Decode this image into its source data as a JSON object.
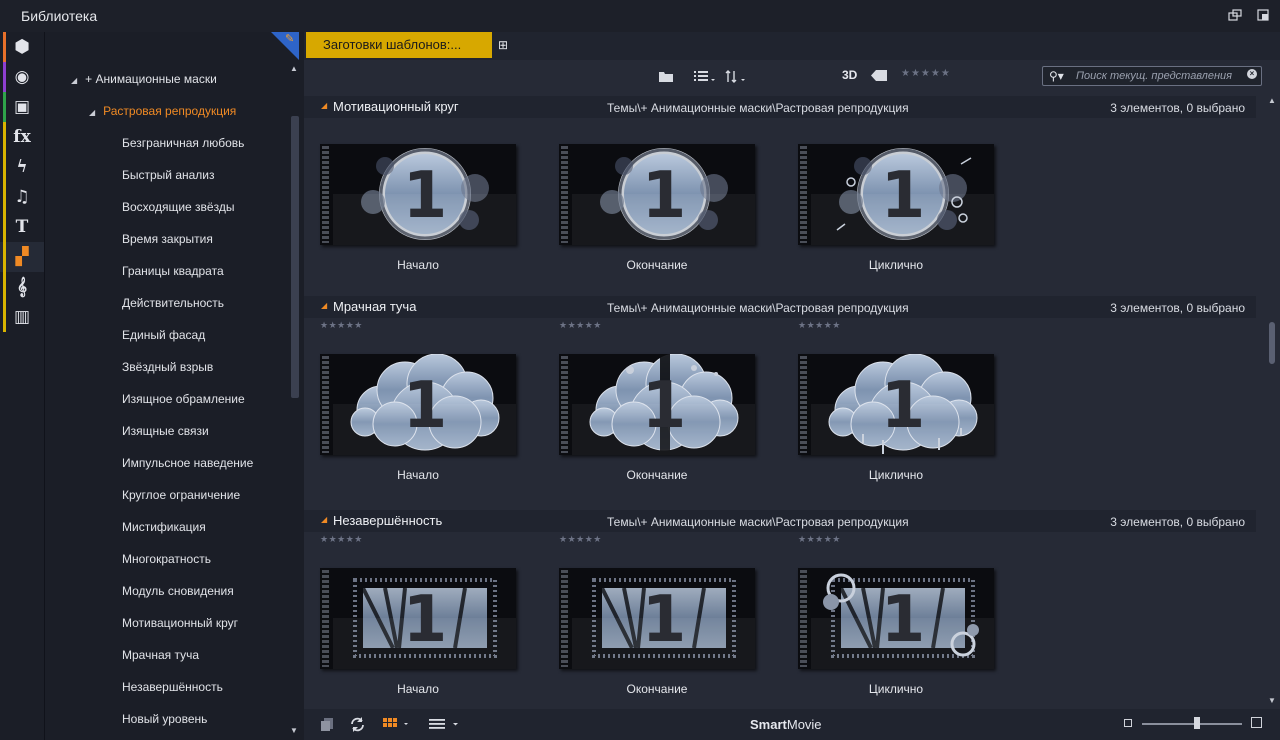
{
  "window": {
    "title": "Библиотека"
  },
  "rail": {
    "items": [
      {
        "name": "project-bin-icon",
        "glyph": "⬢",
        "color": "#e8702a"
      },
      {
        "name": "film-reel-icon",
        "glyph": "◉",
        "color": "#8e3fd0"
      },
      {
        "name": "photos-icon",
        "glyph": "▣",
        "color": "#2fa34a"
      },
      {
        "name": "fx-icon",
        "glyph": "fx",
        "color": "#d9b400"
      },
      {
        "name": "lightning-icon",
        "glyph": "ϟ",
        "color": "#d9b400"
      },
      {
        "name": "music-note-icon",
        "glyph": "♫",
        "color": "#d9b400"
      },
      {
        "name": "title-t-icon",
        "glyph": "T",
        "color": "#d9b400"
      },
      {
        "name": "templates-icon",
        "glyph": "▞",
        "color": "#d9b400"
      },
      {
        "name": "treble-clef-icon",
        "glyph": "𝄞",
        "color": "#d9b400"
      },
      {
        "name": "piano-icon",
        "glyph": "▥",
        "color": "#d9b400"
      }
    ]
  },
  "tree": {
    "parent": "+ Анимационные маски",
    "selected": "Растровая репродукция",
    "children": [
      "Безграничная любовь",
      "Быстрый анализ",
      "Восходящие звёзды",
      "Время закрытия",
      "Границы квадрата",
      "Действительность",
      "Единый фасад",
      "Звёздный взрыв",
      "Изящное обрамление",
      "Изящные связи",
      "Импульсное наведение",
      "Круглое ограничение",
      "Мистификация",
      "Многократность",
      "Модуль сновидения",
      "Мотивационный круг",
      "Мрачная туча",
      "Незавершённость",
      "Новый уровень"
    ]
  },
  "tab": {
    "label": "Заготовки шаблонов:..."
  },
  "toolbar": {
    "mode_3d": "3D",
    "rating": "★★★★★",
    "search_placeholder": "Поиск текущ. представления"
  },
  "sections": [
    {
      "name": "Мотивационный круг",
      "path": "Темы\\+ Анимационные маски\\Растровая репродукция",
      "count": "3 элементов, 0 выбрано",
      "items": [
        {
          "label": "Начало",
          "stars": "",
          "style": "circle"
        },
        {
          "label": "Окончание",
          "stars": "",
          "style": "circle"
        },
        {
          "label": "Циклично",
          "stars": "",
          "style": "circle-burst"
        }
      ]
    },
    {
      "name": "Мрачная туча",
      "path": "Темы\\+ Анимационные маски\\Растровая репродукция",
      "count": "3 элементов, 0 выбрано",
      "items": [
        {
          "label": "Начало",
          "stars": "★★★★★",
          "style": "cloud"
        },
        {
          "label": "Окончание",
          "stars": "★★★★★",
          "style": "cloud-split"
        },
        {
          "label": "Циклично",
          "stars": "★★★★★",
          "style": "cloud-drip"
        }
      ]
    },
    {
      "name": "Незавершённость",
      "path": "Темы\\+ Анимационные маски\\Растровая репродукция",
      "count": "3 элементов, 0 выбрано",
      "items": [
        {
          "label": "Начало",
          "stars": "★★★★★",
          "style": "brush"
        },
        {
          "label": "Окончание",
          "stars": "★★★★★",
          "style": "brush"
        },
        {
          "label": "Циклично",
          "stars": "★★★★★",
          "style": "brush-circles"
        }
      ]
    }
  ],
  "bottom": {
    "brand_bold": "Smart",
    "brand_rest": "Movie",
    "zoom_level": 0.55
  }
}
